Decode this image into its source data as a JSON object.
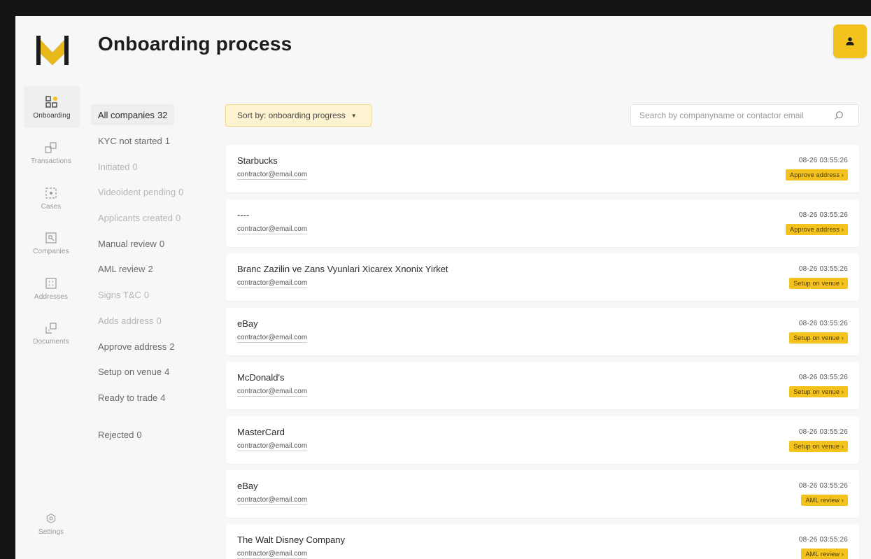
{
  "header": {
    "title": "Onboarding process",
    "user_icon": "user-icon"
  },
  "nav": {
    "items": [
      {
        "label": "Onboarding",
        "icon": "grid-icon"
      },
      {
        "label": "Transactions",
        "icon": "transfer-icon"
      },
      {
        "label": "Cases",
        "icon": "case-icon"
      },
      {
        "label": "Companies",
        "icon": "building-icon"
      },
      {
        "label": "Addresses",
        "icon": "address-icon"
      },
      {
        "label": "Documents",
        "icon": "document-icon"
      }
    ],
    "settings_label": "Settings"
  },
  "filters": [
    {
      "label": "All companies",
      "count": "32"
    },
    {
      "label": "KYC not started",
      "count": "1"
    },
    {
      "label": "Initiated",
      "count": "0"
    },
    {
      "label": "Videoident pending",
      "count": "0"
    },
    {
      "label": "Applicants created",
      "count": "0"
    },
    {
      "label": "Manual review",
      "count": "0"
    },
    {
      "label": "AML review",
      "count": "2"
    },
    {
      "label": "Signs T&C",
      "count": "0"
    },
    {
      "label": "Adds address",
      "count": "0"
    },
    {
      "label": "Approve address",
      "count": "2"
    },
    {
      "label": "Setup on venue",
      "count": "4"
    },
    {
      "label": "Ready to trade",
      "count": "4"
    },
    {
      "label": "Rejected",
      "count": "0"
    }
  ],
  "toolbar": {
    "sort_label": "Sort by: onboarding progress",
    "search_placeholder": "Search by companyname or contactor email"
  },
  "colors": {
    "accent": "#f4c21c",
    "background": "#f7f7f7",
    "frame": "#141417"
  },
  "rows": [
    {
      "name": "Starbucks",
      "email": "contractor@email.com",
      "date": "08-26 03:55:26",
      "status": "Approve address ›"
    },
    {
      "name": "----",
      "email": "contractor@email.com",
      "date": "08-26 03:55:26",
      "status": "Approve address ›"
    },
    {
      "name": "Branc Zazilin ve Zans Vyunlari Xicarex Xnonix Yirket",
      "email": "contractor@email.com",
      "date": "08-26 03:55:26",
      "status": "Setup on venue ›"
    },
    {
      "name": "eBay",
      "email": "contractor@email.com",
      "date": "08-26 03:55:26",
      "status": "Setup on venue ›"
    },
    {
      "name": "McDonald's",
      "email": "contractor@email.com",
      "date": "08-26 03:55:26",
      "status": "Setup on venue ›"
    },
    {
      "name": "MasterCard",
      "email": "contractor@email.com",
      "date": "08-26 03:55:26",
      "status": "Setup on venue ›"
    },
    {
      "name": "eBay",
      "email": "contractor@email.com",
      "date": "08-26 03:55:26",
      "status": "AML review ›"
    },
    {
      "name": "The Walt Disney Company",
      "email": "contractor@email.com",
      "date": "08-26 03:55:26",
      "status": "AML review ›"
    }
  ]
}
